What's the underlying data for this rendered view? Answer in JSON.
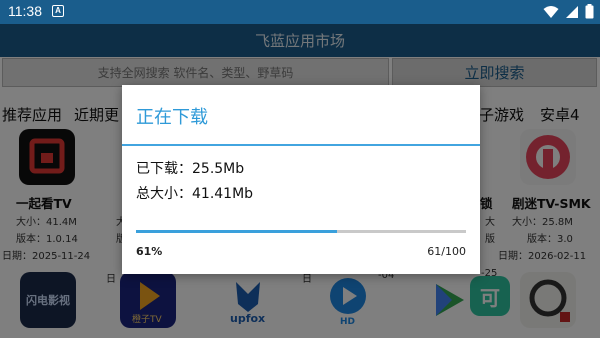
{
  "status_bar": {
    "time": "11:38",
    "notification_icon_text": "A"
  },
  "header": {
    "title": "飞蓝应用市场"
  },
  "search": {
    "placeholder": "支持全网搜索 软件名、类型、野草码",
    "button_label": "立即搜索"
  },
  "tabs": [
    {
      "label": "推荐应用"
    },
    {
      "label": "近期更"
    },
    {
      "label": "子游戏"
    },
    {
      "label": "安卓4"
    }
  ],
  "apps_row1": [
    {
      "name": "一起看TV",
      "size": "大小：41.4M",
      "version": "版本：1.0.14",
      "date": "日期：2025-11-24"
    },
    {
      "name": "剧迷TV-SMK",
      "size": "大小：25.8M",
      "version": "版本：3.0",
      "date": "日期：2026-02-11"
    }
  ],
  "partial_texts": {
    "t1": "大",
    "t2": "版",
    "t3": "日",
    "t4": "锁",
    "t5": "大",
    "t6": "版",
    "t7": "-25",
    "t8": "日",
    "t9": "-04"
  },
  "apps_row2_labels": {
    "a1": "闪电影视",
    "a2": "橙子TV",
    "a3": "upfox",
    "a4": "HD",
    "a5": "可"
  },
  "dialog": {
    "title": "正在下载",
    "downloaded_label": "已下载：",
    "downloaded_value": "25.5Mb",
    "total_label": "总大小：",
    "total_value": "41.41Mb",
    "progress_percent": "61%",
    "progress_count": "61/100",
    "progress_fraction": 0.61
  },
  "colors": {
    "primary": "#1a5d8c",
    "accent": "#2f9ad8",
    "progress": "#3aa0dc"
  }
}
